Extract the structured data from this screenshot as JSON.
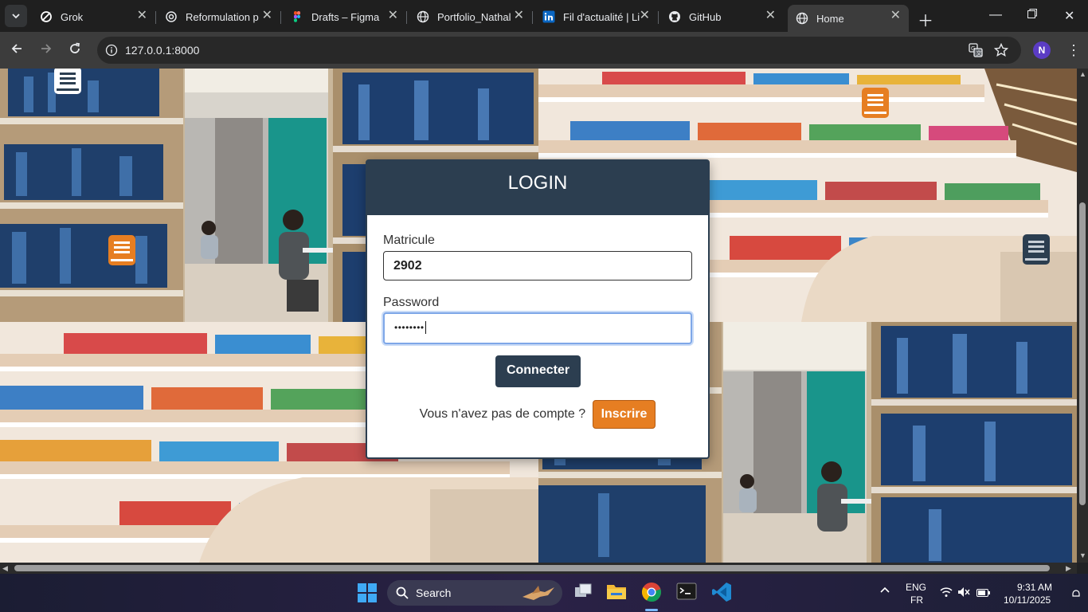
{
  "browser": {
    "tabs": [
      {
        "title": "Grok",
        "icon": "grok-icon",
        "active": false
      },
      {
        "title": "Reformulation p",
        "icon": "chatgpt-icon",
        "active": false
      },
      {
        "title": "Drafts – Figma",
        "icon": "figma-icon",
        "active": false
      },
      {
        "title": "Portfolio_Nathal",
        "icon": "globe-icon",
        "active": false
      },
      {
        "title": "Fil d'actualité | Li",
        "icon": "linkedin-icon",
        "active": false
      },
      {
        "title": "GitHub",
        "icon": "github-icon",
        "active": false
      },
      {
        "title": "Home",
        "icon": "globe-icon",
        "active": true
      }
    ],
    "url": "127.0.0.1:8000",
    "profile_initial": "N"
  },
  "login": {
    "title": "LOGIN",
    "matricule_label": "Matricule",
    "matricule_value": "2902",
    "password_label": "Password",
    "password_value": "••••••••",
    "connect_label": "Connecter",
    "no_account_text": "Vous n'avez pas de compte ?",
    "signup_label": "Inscrire"
  },
  "taskbar": {
    "search_label": "Search",
    "lang_top": "ENG",
    "lang_bottom": "FR",
    "time": "9:31 AM",
    "date": "10/11/2025"
  },
  "colors": {
    "card_header": "#2c3e50",
    "connect_button": "#2c3e50",
    "signup_button": "#e67e22"
  }
}
